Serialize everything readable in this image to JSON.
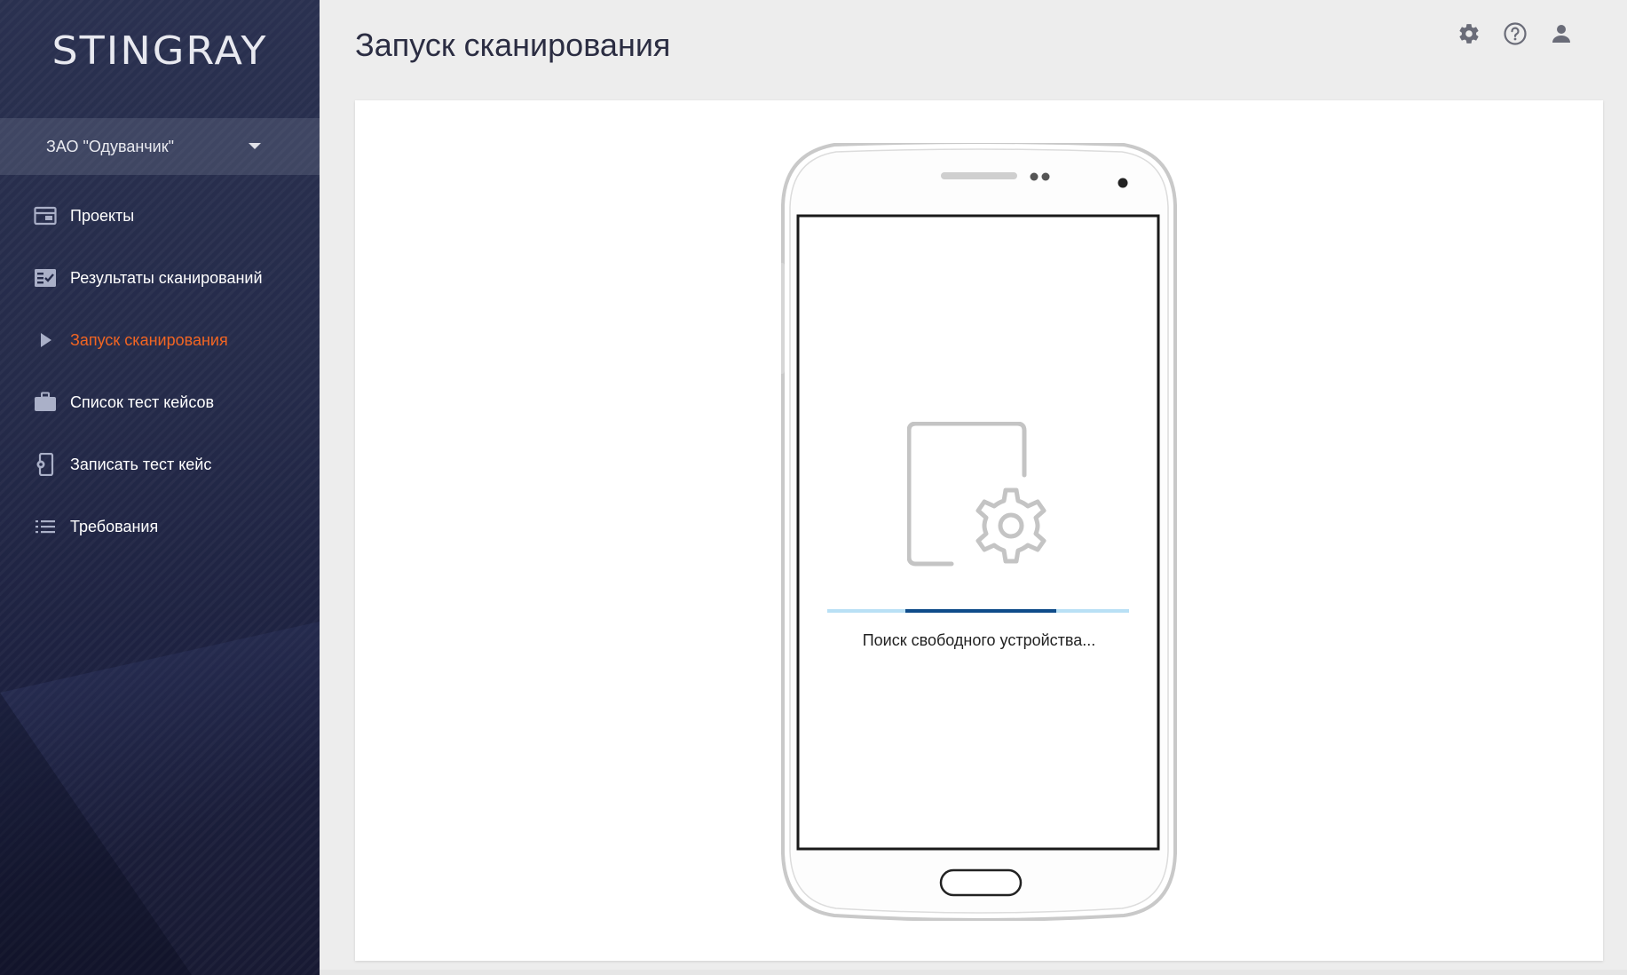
{
  "app": {
    "logo": "STINGRAY"
  },
  "org_selector": {
    "value": "ЗАО \"Одуванчик\""
  },
  "sidebar": {
    "items": [
      {
        "label": "Проекты",
        "icon": "projects-icon",
        "active": false
      },
      {
        "label": "Результаты сканирований",
        "icon": "scan-results-icon",
        "active": false
      },
      {
        "label": "Запуск сканирования",
        "icon": "play-icon",
        "active": true
      },
      {
        "label": "Список тест кейсов",
        "icon": "briefcase-icon",
        "active": false
      },
      {
        "label": "Записать тест кейс",
        "icon": "phone-settings-icon",
        "active": false
      },
      {
        "label": "Требования",
        "icon": "list-icon",
        "active": false
      }
    ]
  },
  "header": {
    "title": "Запуск сканирования",
    "icons": [
      "settings-icon",
      "help-icon",
      "user-icon"
    ]
  },
  "main": {
    "status_text": "Поиск свободного устройства...",
    "progress": {
      "start_fraction": 0.26,
      "end_fraction": 0.76
    }
  },
  "colors": {
    "accent": "#f26522",
    "progress_track": "#b9e0f5",
    "progress_fill": "#0f4c8a",
    "sidebar_bg": "#252b4a"
  }
}
